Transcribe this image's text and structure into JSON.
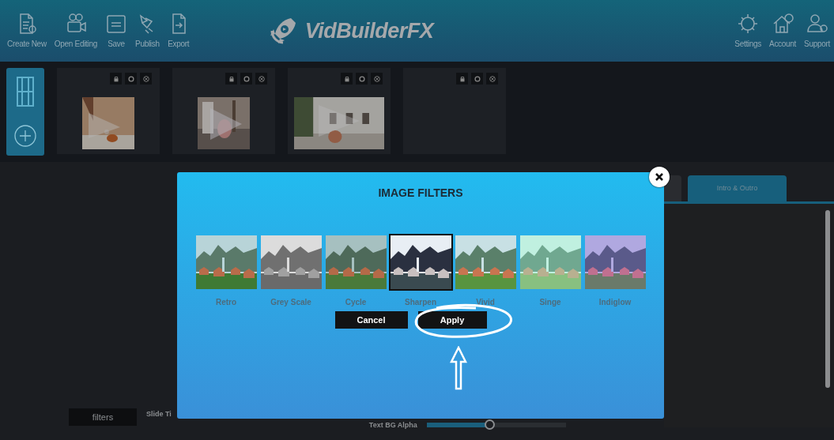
{
  "toolbar": {
    "left": [
      {
        "label": "Create New"
      },
      {
        "label": "Open Editing"
      },
      {
        "label": "Save"
      },
      {
        "label": "Publish"
      },
      {
        "label": "Export"
      }
    ],
    "brand": "VidBuilderFX",
    "right": [
      {
        "label": "Settings"
      },
      {
        "label": "Account"
      },
      {
        "label": "Support"
      }
    ]
  },
  "slides": [
    {
      "kind": "picture"
    },
    {
      "kind": "picture"
    },
    {
      "kind": "picture"
    },
    {
      "kind": "empty"
    }
  ],
  "tabs": [
    {
      "label": "Intro & Outro",
      "selected": true
    }
  ],
  "bottom": {
    "filters_button": "filters",
    "slide_label": "Slide Ti",
    "alpha_label": "Text BG Alpha",
    "alpha_slider": {
      "level": 0.45
    }
  },
  "modal": {
    "title": "IMAGE FILTERS",
    "filters": [
      {
        "label": "Retro",
        "selected": false
      },
      {
        "label": "Grey Scale",
        "selected": false
      },
      {
        "label": "Cycle",
        "selected": false
      },
      {
        "label": "Sharpen",
        "selected": true
      },
      {
        "label": "Vivid",
        "selected": false
      },
      {
        "label": "Singe",
        "selected": false
      },
      {
        "label": "Indiglow",
        "selected": false
      }
    ],
    "buttons": [
      "Cancel",
      "Apply"
    ]
  }
}
